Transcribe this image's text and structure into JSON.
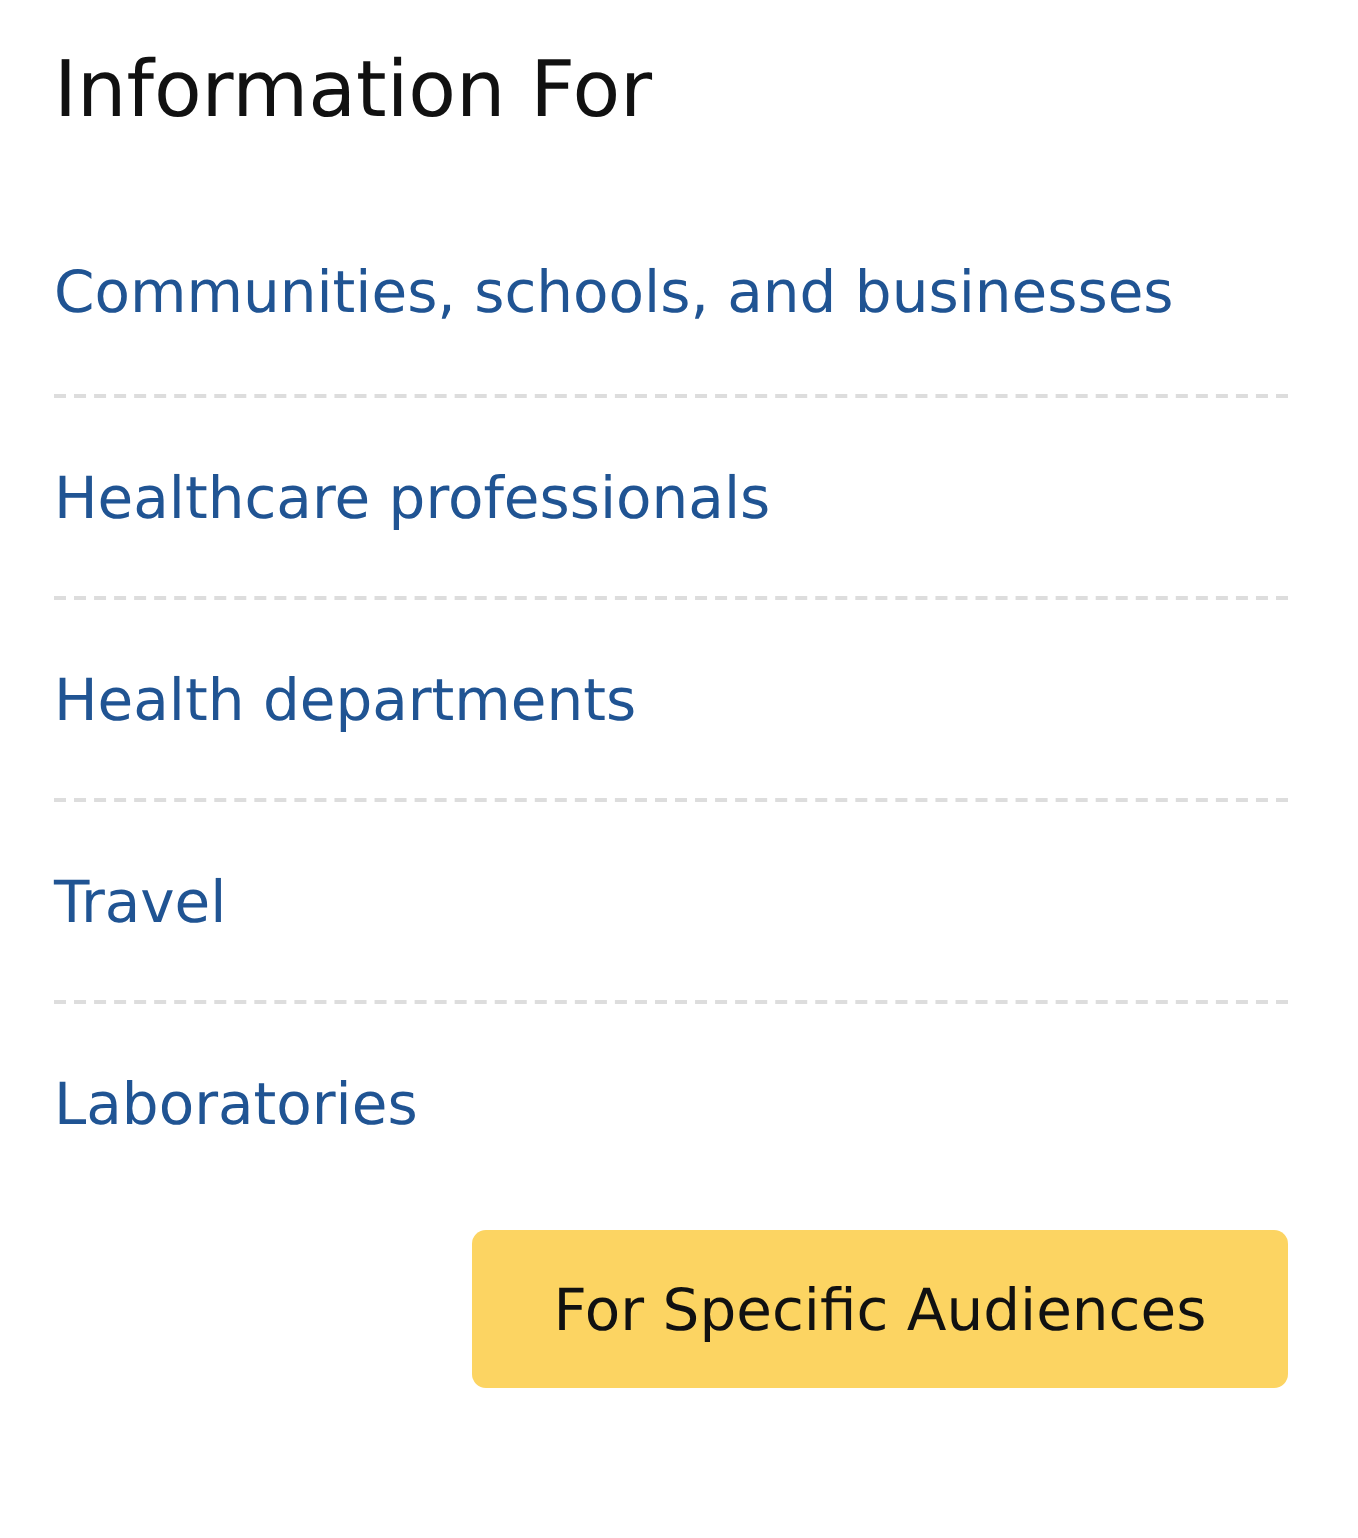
{
  "heading": "Information For",
  "links": [
    {
      "label": "Communities, schools, and businesses"
    },
    {
      "label": "Healthcare professionals"
    },
    {
      "label": "Health departments"
    },
    {
      "label": "Travel"
    },
    {
      "label": "Laboratories"
    }
  ],
  "button": {
    "label": "For Specific Audiences"
  }
}
